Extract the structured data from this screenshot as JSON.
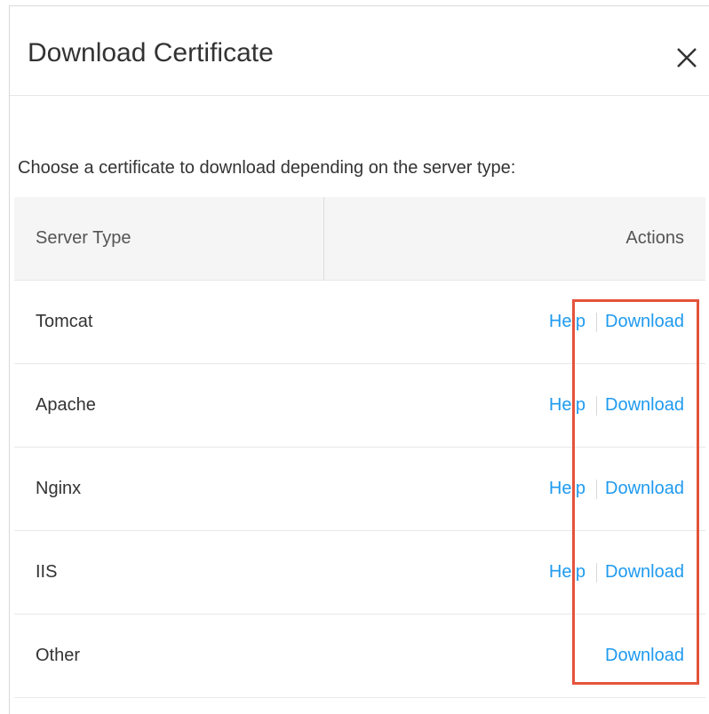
{
  "dialog": {
    "title": "Download Certificate",
    "close_icon": "close-icon",
    "intro_text": "Choose a certificate to download depending on the server type:"
  },
  "table": {
    "headers": {
      "server_type": "Server Type",
      "actions": "Actions"
    },
    "rows": [
      {
        "server_type": "Tomcat",
        "help": "Help",
        "download": "Download"
      },
      {
        "server_type": "Apache",
        "help": "Help",
        "download": "Download"
      },
      {
        "server_type": "Nginx",
        "help": "Help",
        "download": "Download"
      },
      {
        "server_type": "IIS",
        "help": "Help",
        "download": "Download"
      },
      {
        "server_type": "Other",
        "download": "Download"
      }
    ]
  },
  "colors": {
    "link": "#1e9aef",
    "highlight": "#e5533b",
    "header_bg": "#f5f5f5"
  }
}
